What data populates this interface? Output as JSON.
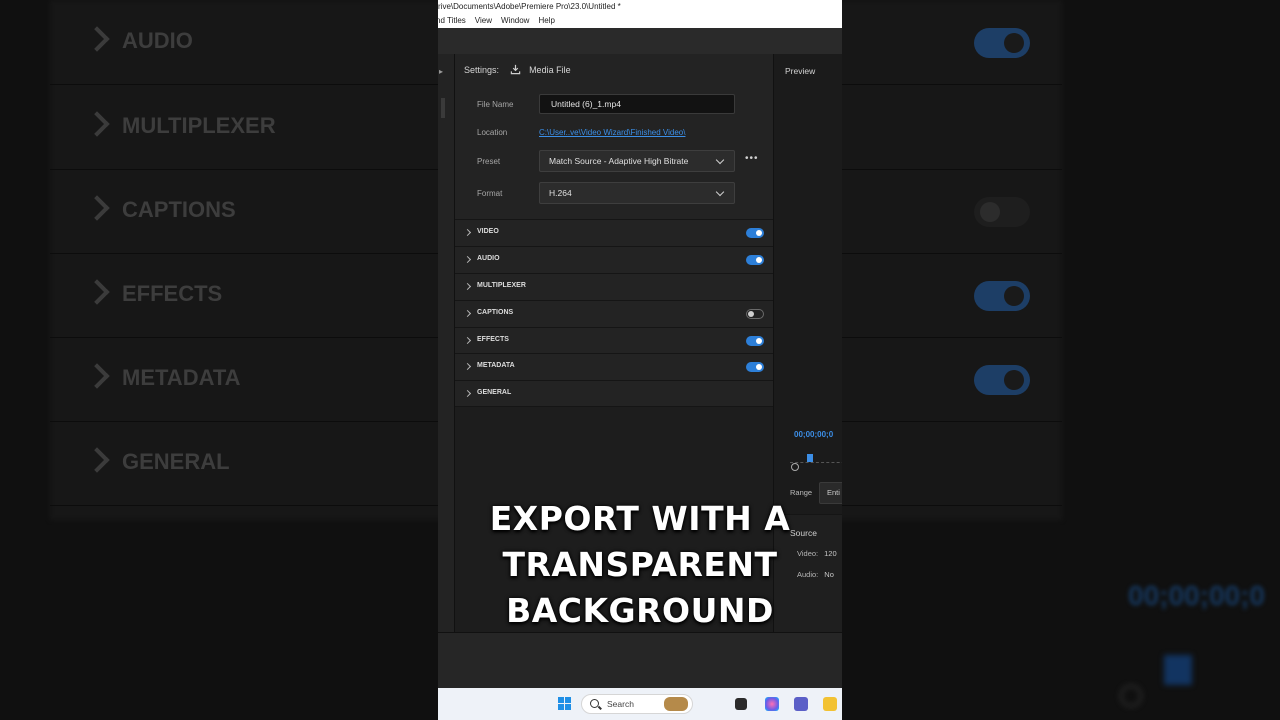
{
  "titlebar": {
    "path": "rive\\Documents\\Adobe\\Premiere Pro\\23.0\\Untitled *"
  },
  "menubar": {
    "items": [
      "nd Titles",
      "View",
      "Window",
      "Help"
    ]
  },
  "export": {
    "settings_label": "Settings:",
    "settings_target": "Media File",
    "file_name_label": "File Name",
    "file_name_value": "Untitled (6)_1.mp4",
    "location_label": "Location",
    "location_value": "C:\\User..ve\\Video Wizard\\Finished Video\\",
    "preset_label": "Preset",
    "preset_value": "Match Source - Adaptive High Bitrate",
    "format_label": "Format",
    "format_value": "H.264",
    "more_label": "•••",
    "sections": [
      {
        "label": "VIDEO",
        "toggle": "on"
      },
      {
        "label": "AUDIO",
        "toggle": "on"
      },
      {
        "label": "MULTIPLEXER",
        "toggle": "none"
      },
      {
        "label": "CAPTIONS",
        "toggle": "off"
      },
      {
        "label": "EFFECTS",
        "toggle": "on"
      },
      {
        "label": "METADATA",
        "toggle": "on"
      },
      {
        "label": "GENERAL",
        "toggle": "none"
      }
    ]
  },
  "preview": {
    "title": "Preview",
    "timecode": "00;00;00;0",
    "range_label": "Range",
    "range_value": "Enti",
    "source_label": "Source",
    "video_label": "Video:",
    "video_value": "120",
    "audio_label": "Audio:",
    "audio_value": "No"
  },
  "background": {
    "labels": [
      "AUDIO",
      "MULTIPLEXER",
      "CAPTIONS",
      "EFFECTS",
      "METADATA",
      "GENERAL"
    ],
    "timecode": "00;00;00;0"
  },
  "taskbar": {
    "search_placeholder": "Search"
  },
  "caption": {
    "line1": "EXPORT WITH A",
    "line2": "TRANSPARENT",
    "line3": "BACKGROUND"
  },
  "colors": {
    "accent": "#2d7fd8",
    "link": "#3b8fe8",
    "panel": "#232323"
  }
}
